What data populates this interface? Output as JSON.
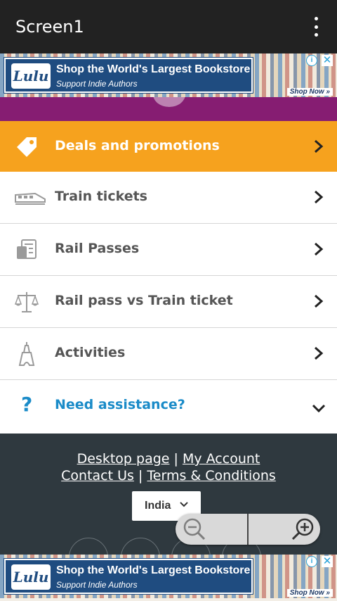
{
  "appbar": {
    "title": "Screen1"
  },
  "ad": {
    "logo": "Lulu",
    "headline": "Shop the World's Largest Bookstore",
    "subline": "Support Indie Authors",
    "cta": "Shop Now »",
    "info": "i",
    "close": "✕"
  },
  "menu": {
    "deals": "Deals and promotions",
    "train_tickets": "Train tickets",
    "rail_passes": "Rail Passes",
    "compare": "Rail pass vs Train ticket",
    "activities": "Activities",
    "help": "Need assistance?",
    "help_icon": "?"
  },
  "footer": {
    "desktop_page": "Desktop page",
    "my_account": "My Account",
    "contact_us": "Contact Us",
    "terms": "Terms & Conditions",
    "separator": "|",
    "country": "India"
  },
  "colors": {
    "appbar": "#222222",
    "deals_bg": "#f6a21e",
    "purple_band": "#861d72",
    "help_blue": "#1a8bc8",
    "footer_bg": "#2f393f"
  }
}
